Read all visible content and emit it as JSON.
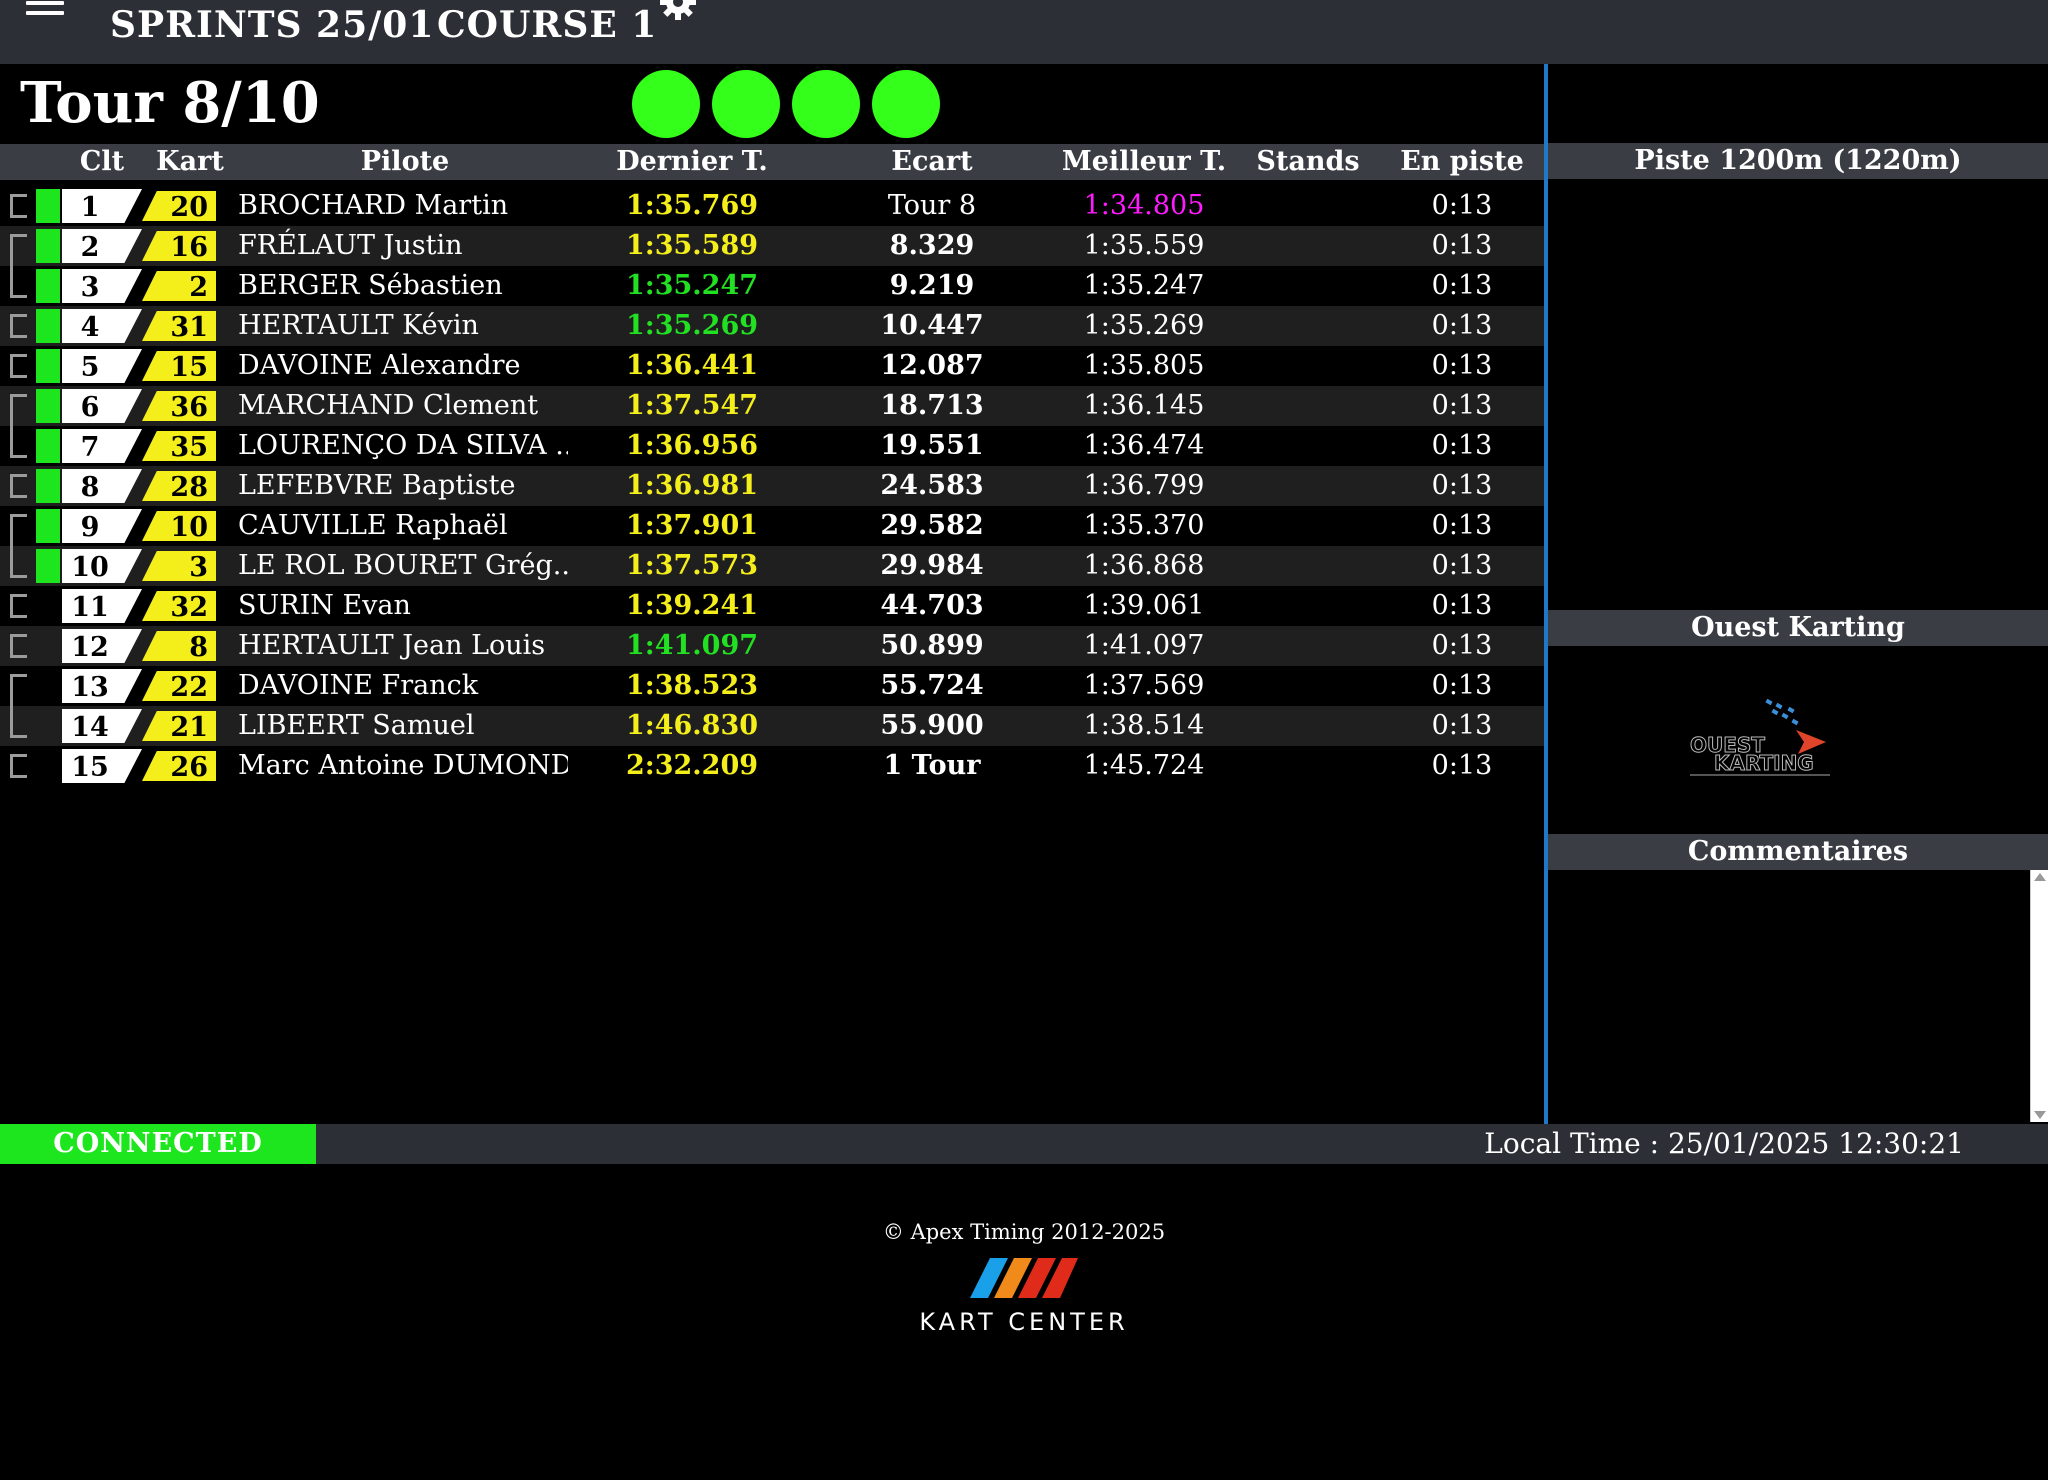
{
  "header": {
    "session_title": "SPRINTS 25/01",
    "race_title": "COURSE 1"
  },
  "lap_indicator": "Tour 8/10",
  "flag_lights": {
    "count": 4,
    "color": "#33ff1a"
  },
  "columns": {
    "position": "Clt",
    "kart": "Kart",
    "driver": "Pilote",
    "last_lap": "Dernier T.",
    "gap": "Ecart",
    "best_lap": "Meilleur T.",
    "pits": "Stands",
    "on_track": "En piste"
  },
  "drivers": [
    {
      "pos": "1",
      "kart": "20",
      "name": "BROCHARD Martin",
      "last": "1:35.769",
      "last_color": "yellow",
      "gap": "Tour 8",
      "best": "1:34.805",
      "best_color": "magenta",
      "pits": "",
      "on_track": "0:13",
      "green": true
    },
    {
      "pos": "2",
      "kart": "16",
      "name": "FRÉLAUT Justin",
      "last": "1:35.589",
      "last_color": "yellow",
      "gap": "8.329",
      "best": "1:35.559",
      "best_color": "white",
      "pits": "",
      "on_track": "0:13",
      "green": true
    },
    {
      "pos": "3",
      "kart": "2",
      "name": "BERGER Sébastien",
      "last": "1:35.247",
      "last_color": "green",
      "gap": "9.219",
      "best": "1:35.247",
      "best_color": "white",
      "pits": "",
      "on_track": "0:13",
      "green": true
    },
    {
      "pos": "4",
      "kart": "31",
      "name": "HERTAULT Kévin",
      "last": "1:35.269",
      "last_color": "green",
      "gap": "10.447",
      "best": "1:35.269",
      "best_color": "white",
      "pits": "",
      "on_track": "0:13",
      "green": true
    },
    {
      "pos": "5",
      "kart": "15",
      "name": "DAVOINE Alexandre",
      "last": "1:36.441",
      "last_color": "yellow",
      "gap": "12.087",
      "best": "1:35.805",
      "best_color": "white",
      "pits": "",
      "on_track": "0:13",
      "green": true
    },
    {
      "pos": "6",
      "kart": "36",
      "name": "MARCHAND Clement",
      "last": "1:37.547",
      "last_color": "yellow",
      "gap": "18.713",
      "best": "1:36.145",
      "best_color": "white",
      "pits": "",
      "on_track": "0:13",
      "green": true
    },
    {
      "pos": "7",
      "kart": "35",
      "name": "LOURENÇO DA SILVA ...",
      "last": "1:36.956",
      "last_color": "yellow",
      "gap": "19.551",
      "best": "1:36.474",
      "best_color": "white",
      "pits": "",
      "on_track": "0:13",
      "green": true
    },
    {
      "pos": "8",
      "kart": "28",
      "name": "LEFEBVRE Baptiste",
      "last": "1:36.981",
      "last_color": "yellow",
      "gap": "24.583",
      "best": "1:36.799",
      "best_color": "white",
      "pits": "",
      "on_track": "0:13",
      "green": true
    },
    {
      "pos": "9",
      "kart": "10",
      "name": "CAUVILLE Raphaël",
      "last": "1:37.901",
      "last_color": "yellow",
      "gap": "29.582",
      "best": "1:35.370",
      "best_color": "white",
      "pits": "",
      "on_track": "0:13",
      "green": true
    },
    {
      "pos": "10",
      "kart": "3",
      "name": "LE ROL BOURET Grég...",
      "last": "1:37.573",
      "last_color": "yellow",
      "gap": "29.984",
      "best": "1:36.868",
      "best_color": "white",
      "pits": "",
      "on_track": "0:13",
      "green": true
    },
    {
      "pos": "11",
      "kart": "32",
      "name": "SURIN Evan",
      "last": "1:39.241",
      "last_color": "yellow",
      "gap": "44.703",
      "best": "1:39.061",
      "best_color": "white",
      "pits": "",
      "on_track": "0:13",
      "green": false
    },
    {
      "pos": "12",
      "kart": "8",
      "name": "HERTAULT Jean Louis",
      "last": "1:41.097",
      "last_color": "green",
      "gap": "50.899",
      "best": "1:41.097",
      "best_color": "white",
      "pits": "",
      "on_track": "0:13",
      "green": false
    },
    {
      "pos": "13",
      "kart": "22",
      "name": "DAVOINE Franck",
      "last": "1:38.523",
      "last_color": "yellow",
      "gap": "55.724",
      "best": "1:37.569",
      "best_color": "white",
      "pits": "",
      "on_track": "0:13",
      "green": false
    },
    {
      "pos": "14",
      "kart": "21",
      "name": "LIBEERT Samuel",
      "last": "1:46.830",
      "last_color": "yellow",
      "gap": "55.900",
      "best": "1:38.514",
      "best_color": "white",
      "pits": "",
      "on_track": "0:13",
      "green": false
    },
    {
      "pos": "15",
      "kart": "26",
      "name": "Marc Antoine DUMOND",
      "last": "2:32.209",
      "last_color": "yellow",
      "gap": "1 Tour",
      "best": "1:45.724",
      "best_color": "white",
      "pits": "",
      "on_track": "0:13",
      "green": false
    }
  ],
  "panels": {
    "track_title": "Piste 1200m (1220m)",
    "sponsor_title": "Ouest Karting",
    "sponsor_logo_line1": "OUEST",
    "sponsor_logo_line2": "KARTING",
    "comments_title": "Commentaires"
  },
  "status": {
    "connection": "CONNECTED",
    "local_time": "Local Time : 25/01/2025 12:30:21"
  },
  "footer": {
    "copyright": "© Apex Timing 2012-2025",
    "logo_text": "KART CENTER"
  },
  "colors": {
    "accent_blue": "#1f78c8",
    "connected_green": "#1ee61e",
    "best_lap_magenta": "#ff1aff",
    "personal_best_green": "#22e022",
    "lap_yellow": "#f4ee1a"
  }
}
